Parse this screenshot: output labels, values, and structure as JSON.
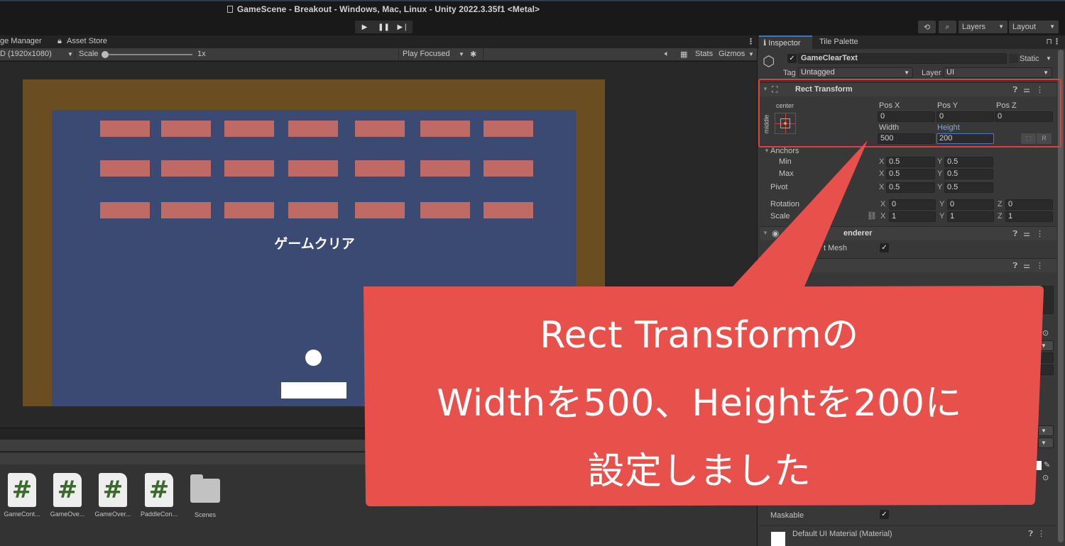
{
  "window": {
    "title": "GameScene - Breakout - Windows, Mac, Linux - Unity 2022.3.35f1 <Metal>"
  },
  "toolbar": {
    "play_icon": "play-icon",
    "pause_icon": "pause-icon",
    "step_icon": "step-icon",
    "history_icon": "history-icon",
    "search_icon": "search-icon",
    "layers_label": "Layers",
    "layout_label": "Layout"
  },
  "game_view": {
    "tabs": [
      "ge Manager",
      "Asset Store"
    ],
    "resolution": "D (1920x1080)",
    "scale_label": "Scale",
    "scale_value": "1x",
    "play_mode": "Play Focused",
    "stats_label": "Stats",
    "gizmos_label": "Gizmos",
    "game_clear_text": "ゲームクリア",
    "brick_rows": 3,
    "brick_cols": 7,
    "colors": {
      "frame": "#6b4d22",
      "field": "#3b4a72",
      "brick": "#c06a66"
    }
  },
  "project": {
    "assets": [
      {
        "name": "GameCont...",
        "type": "script"
      },
      {
        "name": "GameOve...",
        "type": "script"
      },
      {
        "name": "GameOver...",
        "type": "script"
      },
      {
        "name": "PaddleCon...",
        "type": "script"
      },
      {
        "name": "Scenes",
        "type": "folder"
      }
    ]
  },
  "inspector": {
    "tabs": [
      "Inspector",
      "Tile Palette"
    ],
    "object_name": "GameClearText",
    "active": true,
    "static_label": "Static",
    "tag_label": "Tag",
    "tag_value": "Untagged",
    "layer_label": "Layer",
    "layer_value": "UI",
    "rect_transform": {
      "title": "Rect Transform",
      "anchor_h": "center",
      "anchor_v": "middle",
      "pos_x_label": "Pos X",
      "pos_y_label": "Pos Y",
      "pos_z_label": "Pos Z",
      "pos_x": "0",
      "pos_y": "0",
      "pos_z": "0",
      "width_label": "Width",
      "height_label": "Height",
      "width": "500",
      "height": "200",
      "raw_button": "R",
      "anchors_label": "Anchors",
      "min_label": "Min",
      "max_label": "Max",
      "min_x": "0.5",
      "min_y": "0.5",
      "max_x": "0.5",
      "max_y": "0.5",
      "pivot_label": "Pivot",
      "pivot_x": "0.5",
      "pivot_y": "0.5",
      "rotation_label": "Rotation",
      "rot_x": "0",
      "rot_y": "0",
      "rot_z": "0",
      "scale_label": "Scale",
      "scale_x": "1",
      "scale_y": "1",
      "scale_z": "1"
    },
    "canvas_renderer": {
      "title": "enderer",
      "cull_label": "t Mesh",
      "cull_checked": true
    },
    "maskable_label": "Maskable",
    "maskable_checked": true,
    "material_label": "Default UI Material (Material)"
  },
  "callout": {
    "line1": "Rect Transformの",
    "line2": "Widthを500、Heightを200に",
    "line3": "設定しました",
    "color": "#e8514b"
  }
}
